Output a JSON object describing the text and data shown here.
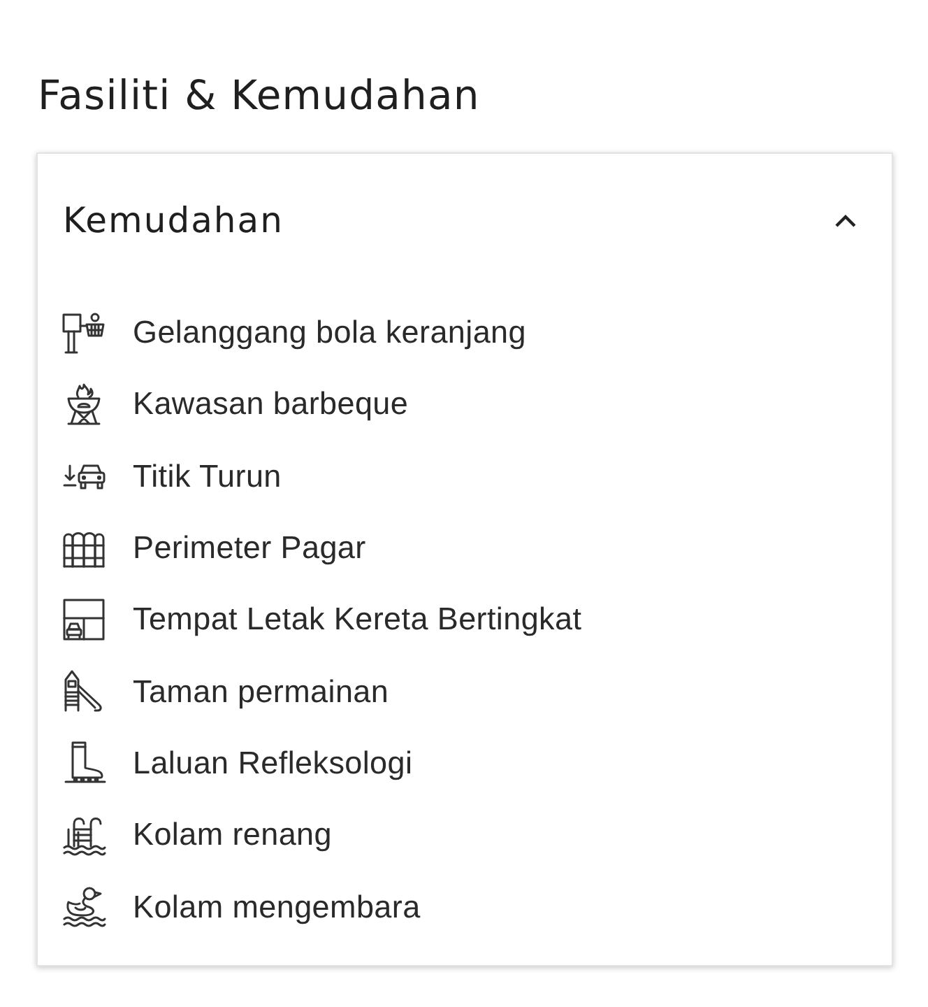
{
  "section": {
    "title": "Fasiliti & Kemudahan"
  },
  "amenities": {
    "title": "Kemudahan",
    "expanded": true,
    "items": [
      {
        "label": "Gelanggang bola keranjang"
      },
      {
        "label": "Kawasan barbeque"
      },
      {
        "label": "Titik Turun"
      },
      {
        "label": "Perimeter Pagar"
      },
      {
        "label": "Tempat Letak Kereta Bertingkat"
      },
      {
        "label": "Taman permainan"
      },
      {
        "label": "Laluan Refleksologi"
      },
      {
        "label": "Kolam renang"
      },
      {
        "label": "Kolam mengembara"
      }
    ]
  }
}
